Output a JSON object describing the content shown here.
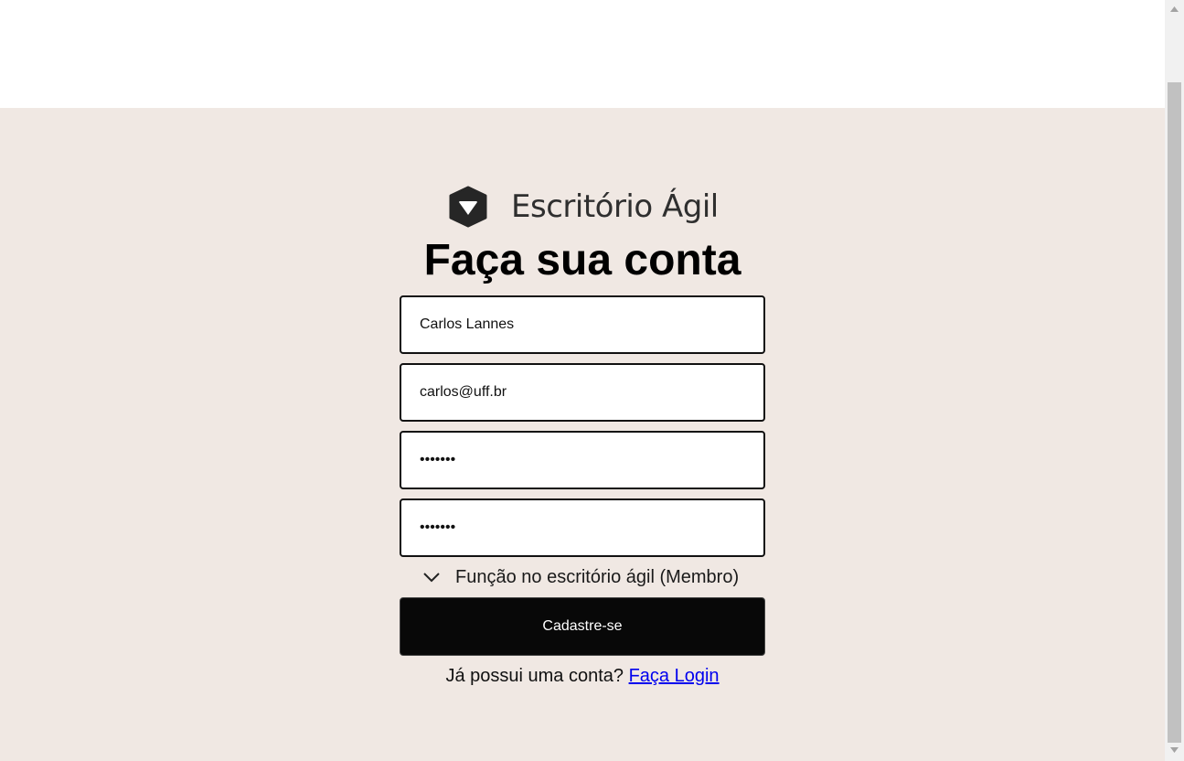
{
  "brand": {
    "name": "Escritório Ágil",
    "logo_icon": "shield-check-icon"
  },
  "form": {
    "title": "Faça sua conta",
    "name_value": "Carlos Lannes",
    "email_value": "carlos@uff.br",
    "password_value": "•••••••",
    "confirm_password_value": "•••••••",
    "role_label": "Função no escritório ágil (Membro)",
    "role_icon": "chevron-down-icon",
    "submit_label": "Cadastre-se"
  },
  "footer": {
    "prompt": "Já possui uma conta?",
    "login_link": "Faça Login"
  },
  "colors": {
    "background": "#f0e8e3",
    "button": "#080808",
    "link": "#0000ee"
  }
}
